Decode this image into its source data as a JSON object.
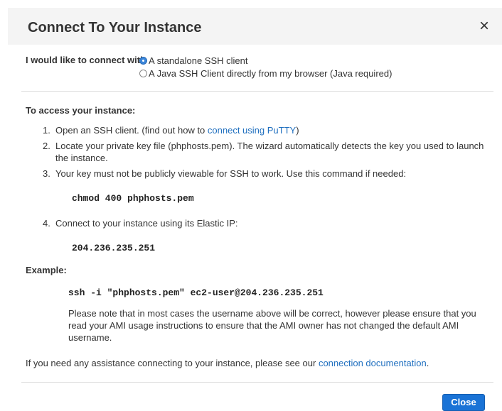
{
  "dialog": {
    "title": "Connect To Your Instance",
    "close_icon": "×"
  },
  "connect": {
    "label": "I would like to connect with",
    "options": [
      {
        "label": "A standalone SSH client",
        "selected": true
      },
      {
        "label": "A Java SSH Client directly from my browser (Java required)",
        "selected": false
      }
    ]
  },
  "access": {
    "heading": "To access your instance:",
    "steps": [
      {
        "num": "1.",
        "text_before": "Open an SSH client. (find out how to ",
        "link": "connect using PuTTY",
        "text_after": ")"
      },
      {
        "num": "2.",
        "text": "Locate your private key file (phphosts.pem). The wizard automatically detects the key you used to launch the instance."
      },
      {
        "num": "3.",
        "text": "Your key must not be publicly viewable for SSH to work. Use this command if needed:"
      },
      {
        "num": "4.",
        "text": "Connect to your instance using its Elastic IP:"
      }
    ],
    "chmod_command": "chmod 400 phphosts.pem",
    "elastic_ip": "204.236.235.251"
  },
  "example": {
    "heading": "Example:",
    "command": "ssh -i \"phphosts.pem\" ec2-user@204.236.235.251",
    "note": "Please note that in most cases the username above will be correct, however please ensure that you read your AMI usage instructions to ensure that the AMI owner has not changed the default AMI username."
  },
  "assist": {
    "text": "If you need any assistance connecting to your instance, please see our ",
    "link": "connection documentation",
    "suffix": "."
  },
  "footer": {
    "close_label": "Close"
  },
  "colors": {
    "link": "#1f6fbf",
    "primary_button": "#1a73d6",
    "header_bg": "#f4f4f4"
  }
}
